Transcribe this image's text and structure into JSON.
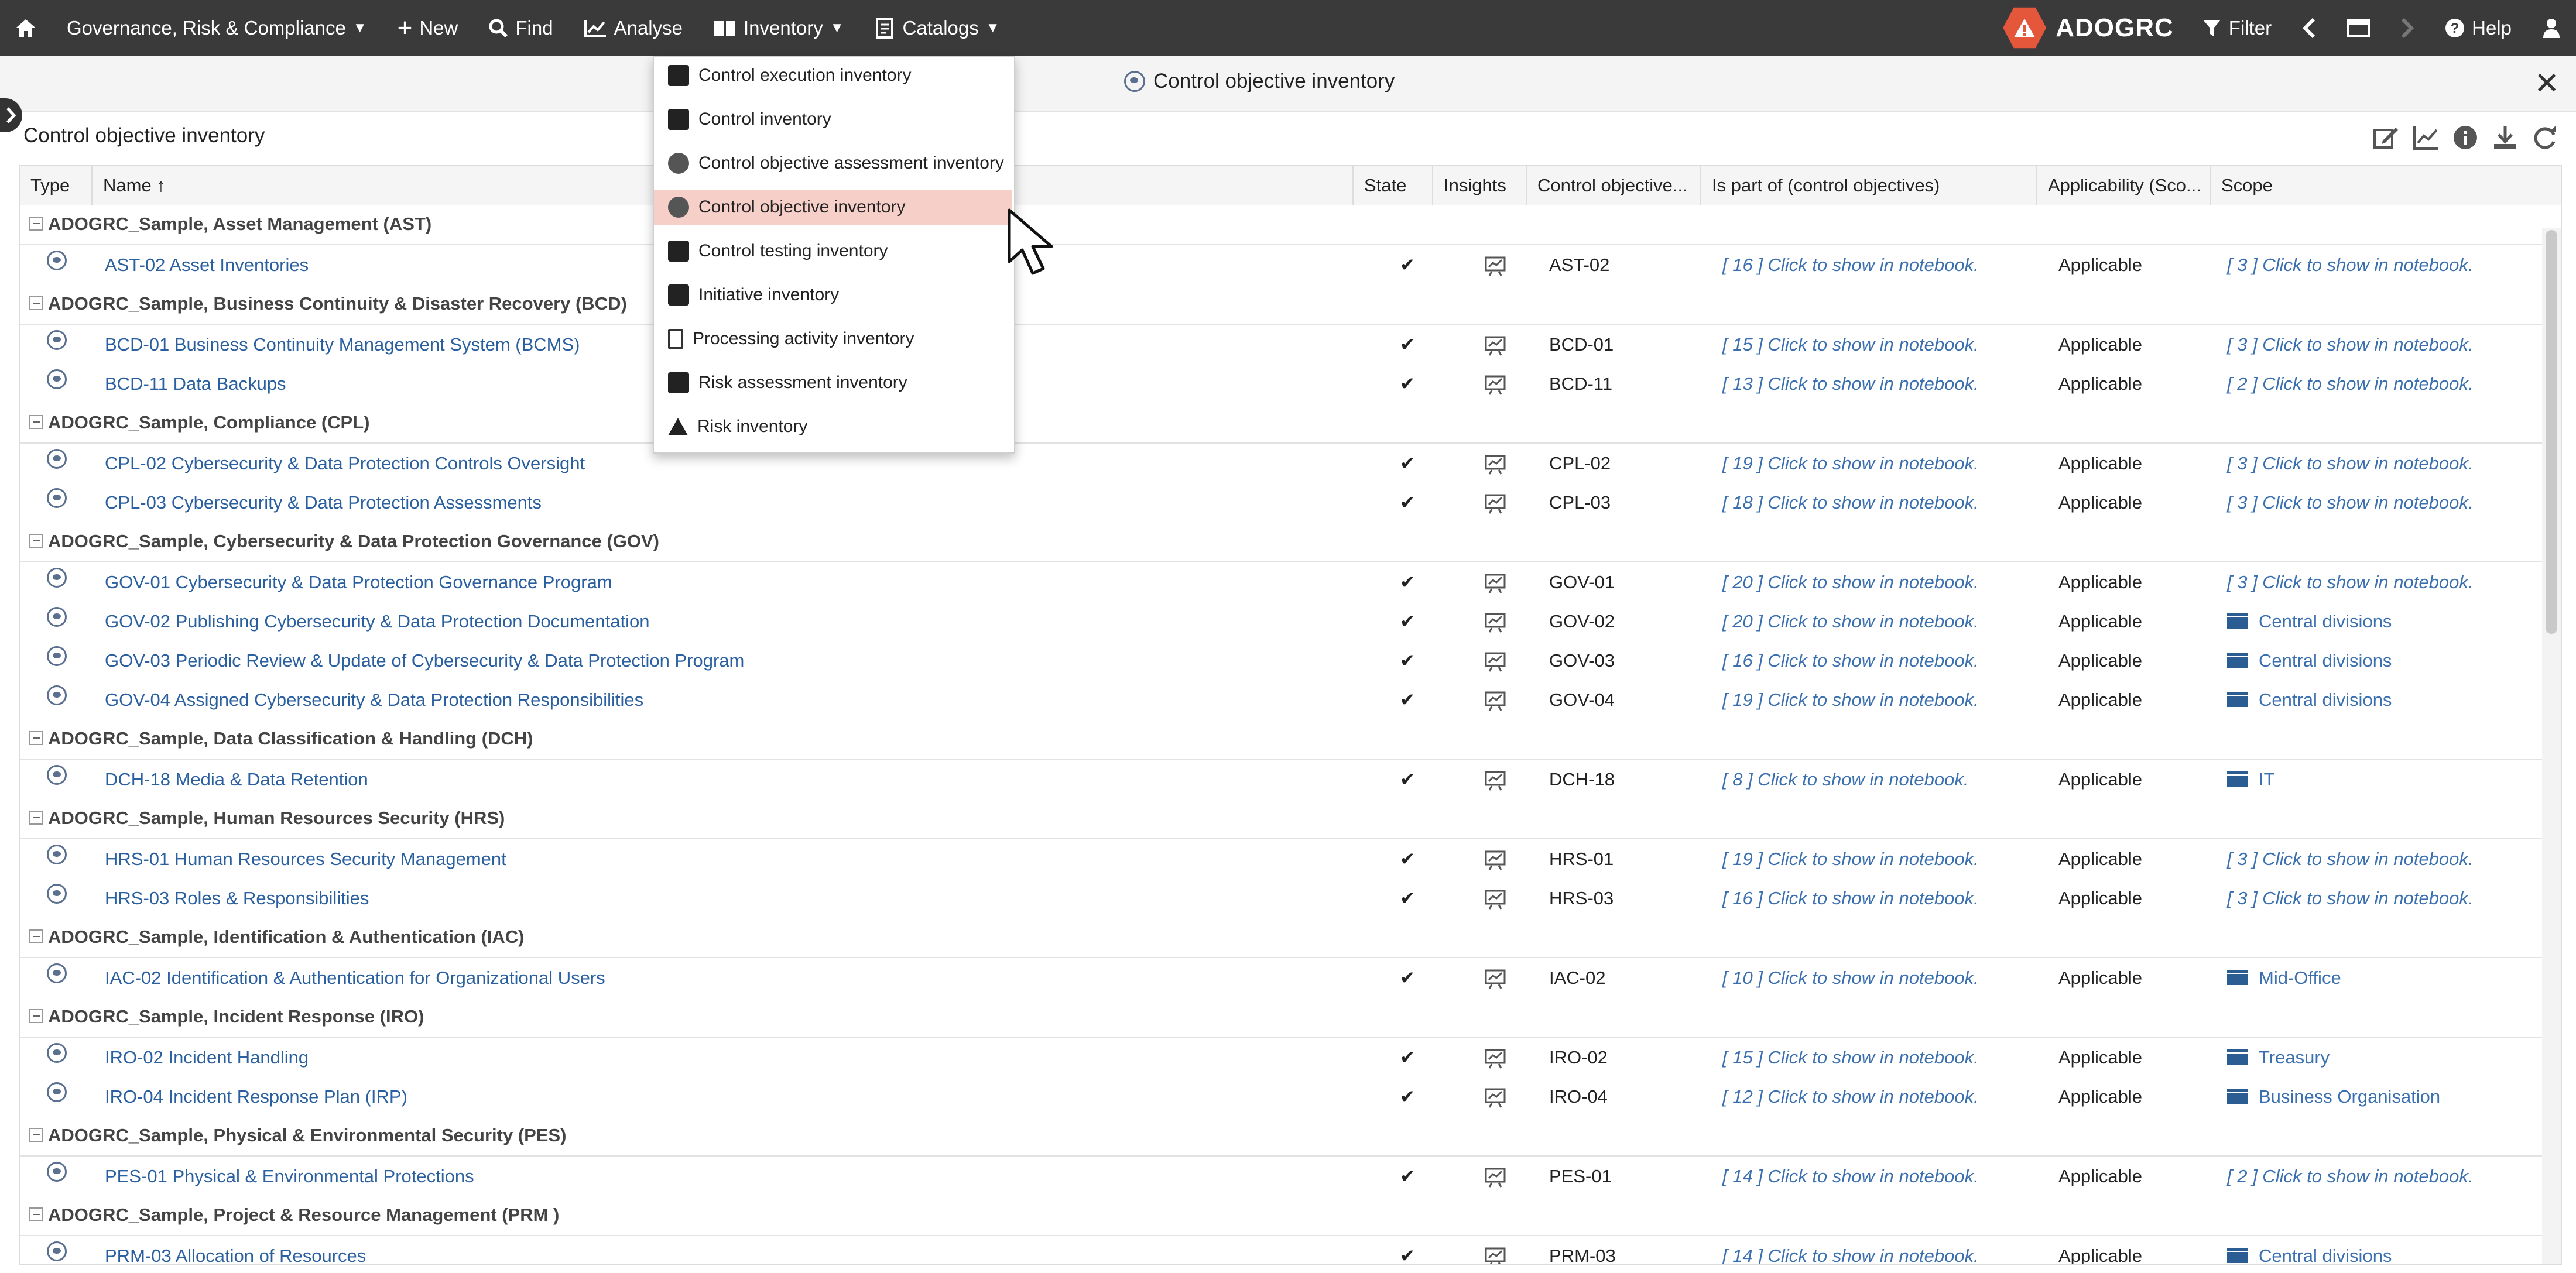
{
  "nav": {
    "home_icon": "home-icon",
    "app_label": "Governance, Risk & Compliance",
    "new_label": "New",
    "find_label": "Find",
    "analyse_label": "Analyse",
    "inventory_label": "Inventory",
    "catalogs_label": "Catalogs",
    "brand": "ADOGRC",
    "filter_label": "Filter",
    "help_label": "Help"
  },
  "notebook": {
    "title": "Control objective inventory",
    "section_title": "Control objective inventory"
  },
  "inventory_menu": {
    "items": [
      {
        "label": "Control execution inventory",
        "icon": "search-icon"
      },
      {
        "label": "Control inventory",
        "icon": "search-icon"
      },
      {
        "label": "Control objective assessment inventory",
        "icon": "assessment-icon"
      },
      {
        "label": "Control objective inventory",
        "icon": "eye-icon",
        "active": true
      },
      {
        "label": "Control testing inventory",
        "icon": "search-icon"
      },
      {
        "label": "Initiative inventory",
        "icon": "initiative-icon"
      },
      {
        "label": "Processing activity inventory",
        "icon": "document-icon"
      },
      {
        "label": "Risk assessment inventory",
        "icon": "risk-assessment-icon"
      },
      {
        "label": "Risk inventory",
        "icon": "warning-icon"
      }
    ]
  },
  "table": {
    "columns": [
      "Type",
      "Name ↑",
      "State",
      "Insights",
      "Control objective...",
      "Is part of (control objectives)",
      "Applicability (Sco...",
      "Scope"
    ],
    "groups": [
      {
        "label": "ADOGRC_Sample, Asset Management (AST)",
        "rows": [
          {
            "name": "AST-02 Asset Inventories",
            "state": "✔",
            "id": "AST-02",
            "part_of": "[ 16 ] Click to show in notebook.",
            "applicability": "Applicable",
            "scope": "[ 3 ] Click to show in notebook.",
            "scope_link": true
          }
        ]
      },
      {
        "label": "ADOGRC_Sample, Business Continuity & Disaster Recovery (BCD)",
        "rows": [
          {
            "name": "BCD-01 Business Continuity Management System (BCMS)",
            "state": "✔",
            "id": "BCD-01",
            "part_of": "[ 15 ] Click to show in notebook.",
            "applicability": "Applicable",
            "scope": "[ 3 ] Click to show in notebook.",
            "scope_link": true
          },
          {
            "name": "BCD-11 Data Backups",
            "state": "✔",
            "id": "BCD-11",
            "part_of": "[ 13 ] Click to show in notebook.",
            "applicability": "Applicable",
            "scope": "[ 2 ] Click to show in notebook.",
            "scope_link": true
          }
        ]
      },
      {
        "label": "ADOGRC_Sample, Compliance (CPL)",
        "rows": [
          {
            "name": "CPL-02 Cybersecurity & Data Protection Controls Oversight",
            "state": "✔",
            "id": "CPL-02",
            "part_of": "[ 19 ] Click to show in notebook.",
            "applicability": "Applicable",
            "scope": "[ 3 ] Click to show in notebook.",
            "scope_link": true
          },
          {
            "name": "CPL-03 Cybersecurity & Data Protection Assessments",
            "state": "✔",
            "id": "CPL-03",
            "part_of": "[ 18 ] Click to show in notebook.",
            "applicability": "Applicable",
            "scope": "[ 3 ] Click to show in notebook.",
            "scope_link": true
          }
        ]
      },
      {
        "label": "ADOGRC_Sample, Cybersecurity & Data Protection Governance (GOV)",
        "rows": [
          {
            "name": "GOV-01 Cybersecurity & Data Protection Governance Program",
            "state": "✔",
            "id": "GOV-01",
            "part_of": "[ 20 ] Click to show in notebook.",
            "applicability": "Applicable",
            "scope": "[ 3 ] Click to show in notebook.",
            "scope_link": true
          },
          {
            "name": "GOV-02 Publishing Cybersecurity & Data Protection Documentation",
            "state": "✔",
            "id": "GOV-02",
            "part_of": "[ 20 ] Click to show in notebook.",
            "applicability": "Applicable",
            "scope": "Central divisions",
            "scope_link": false
          },
          {
            "name": "GOV-03 Periodic Review & Update of Cybersecurity & Data Protection Program",
            "state": "✔",
            "id": "GOV-03",
            "part_of": "[ 16 ] Click to show in notebook.",
            "applicability": "Applicable",
            "scope": "Central divisions",
            "scope_link": false
          },
          {
            "name": "GOV-04 Assigned Cybersecurity & Data Protection Responsibilities",
            "state": "✔",
            "id": "GOV-04",
            "part_of": "[ 19 ] Click to show in notebook.",
            "applicability": "Applicable",
            "scope": "Central divisions",
            "scope_link": false
          }
        ]
      },
      {
        "label": "ADOGRC_Sample, Data Classification & Handling (DCH)",
        "rows": [
          {
            "name": "DCH-18 Media & Data Retention",
            "state": "✔",
            "id": "DCH-18",
            "part_of": "[ 8 ] Click to show in notebook.",
            "applicability": "Applicable",
            "scope": "IT",
            "scope_link": false
          }
        ]
      },
      {
        "label": "ADOGRC_Sample, Human Resources Security (HRS)",
        "rows": [
          {
            "name": "HRS-01 Human Resources Security Management",
            "state": "✔",
            "id": "HRS-01",
            "part_of": "[ 19 ] Click to show in notebook.",
            "applicability": "Applicable",
            "scope": "[ 3 ] Click to show in notebook.",
            "scope_link": true
          },
          {
            "name": "HRS-03 Roles & Responsibilities",
            "state": "✔",
            "id": "HRS-03",
            "part_of": "[ 16 ] Click to show in notebook.",
            "applicability": "Applicable",
            "scope": "[ 3 ] Click to show in notebook.",
            "scope_link": true
          }
        ]
      },
      {
        "label": "ADOGRC_Sample, Identification & Authentication (IAC)",
        "rows": [
          {
            "name": "IAC-02 Identification & Authentication for Organizational Users",
            "state": "✔",
            "id": "IAC-02",
            "part_of": "[ 10 ] Click to show in notebook.",
            "applicability": "Applicable",
            "scope": "Mid-Office",
            "scope_link": false
          }
        ]
      },
      {
        "label": "ADOGRC_Sample, Incident Response (IRO)",
        "rows": [
          {
            "name": "IRO-02 Incident Handling",
            "state": "✔",
            "id": "IRO-02",
            "part_of": "[ 15 ] Click to show in notebook.",
            "applicability": "Applicable",
            "scope": "Treasury",
            "scope_link": false
          },
          {
            "name": "IRO-04 Incident Response Plan (IRP)",
            "state": "✔",
            "id": "IRO-04",
            "part_of": "[ 12 ] Click to show in notebook.",
            "applicability": "Applicable",
            "scope": "Business Organisation",
            "scope_link": false
          }
        ]
      },
      {
        "label": "ADOGRC_Sample, Physical & Environmental Security (PES)",
        "rows": [
          {
            "name": "PES-01 Physical & Environmental Protections",
            "state": "✔",
            "id": "PES-01",
            "part_of": "[ 14 ] Click to show in notebook.",
            "applicability": "Applicable",
            "scope": "[ 2 ] Click to show in notebook.",
            "scope_link": true
          }
        ]
      },
      {
        "label": "ADOGRC_Sample, Project & Resource Management (PRM )",
        "rows": [
          {
            "name": "PRM-03 Allocation of Resources",
            "state": "✔",
            "id": "PRM-03",
            "part_of": "[ 14 ] Click to show in notebook.",
            "applicability": "Applicable",
            "scope": "Central divisions",
            "scope_link": false
          }
        ]
      }
    ]
  },
  "colors": {
    "topbar": "#3a3a3a",
    "brand": "#e4573b",
    "link": "#3a6fb0",
    "active_menu": "#f6cfc9"
  }
}
